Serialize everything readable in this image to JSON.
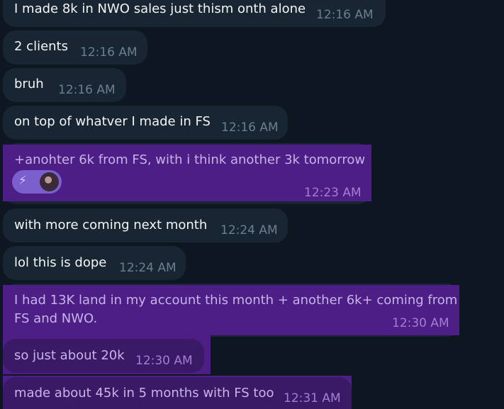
{
  "messages": [
    {
      "text": "I made 8k in NWO sales just thism onth alone",
      "time": "12:16 AM"
    },
    {
      "text": "2 clients",
      "time": "12:16 AM"
    },
    {
      "text": "bruh",
      "time": "12:16 AM"
    },
    {
      "text": "on top of whatver I made in FS",
      "time": "12:16 AM"
    },
    {
      "text": "+anohter 6k from FS, with i think another 3k tomorrow",
      "time": "12:23 AM",
      "reaction_emoji": "⚡",
      "reaction_icon": "lightning-icon"
    },
    {
      "text": "with more coming next month",
      "time": "12:24 AM"
    },
    {
      "text": "lol this is dope",
      "time": "12:24 AM"
    },
    {
      "text_line1": "I had 13K land in my account this month + another 6k+ coming from",
      "text_line2": "FS and NWO.",
      "time": "12:30 AM"
    },
    {
      "text": "so just about 20k",
      "time": "12:30 AM"
    },
    {
      "text": "made about 45k in 5 months with FS too",
      "time": "12:31 AM"
    }
  ],
  "colors": {
    "background": "#0e1621",
    "bubble": "#182533",
    "highlight": "#4c1e86",
    "text": "#f5f5f5",
    "time": "#6d7f8f"
  }
}
